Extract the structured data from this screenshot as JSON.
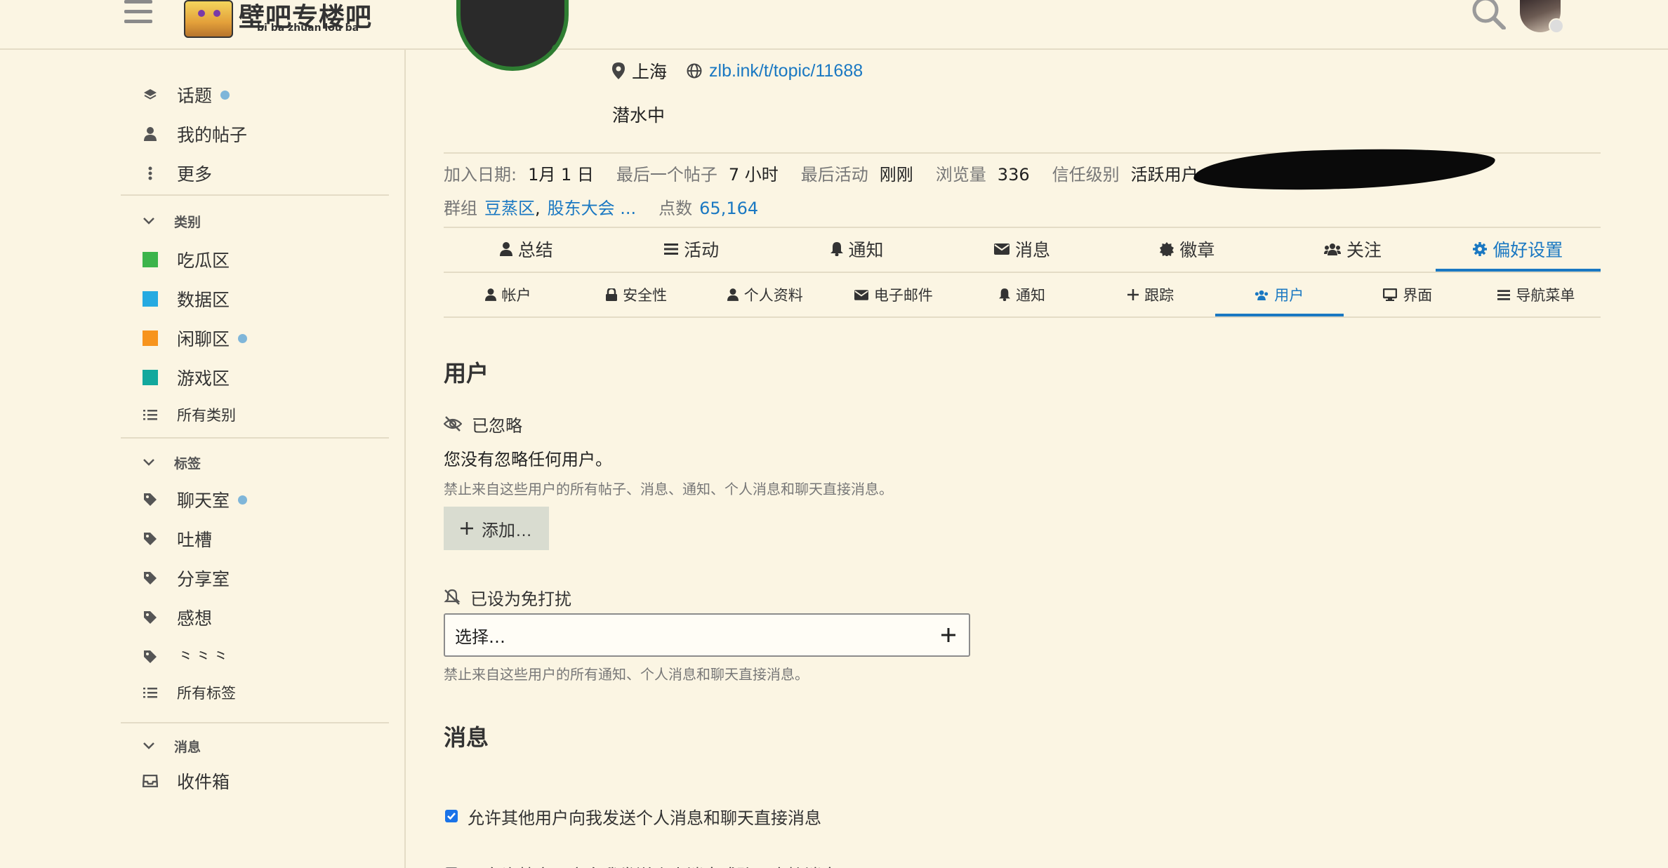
{
  "header": {
    "logo_title": "壁吧专楼吧",
    "logo_subtitle": "bi ba zhuan lou ba"
  },
  "sidebar": {
    "nav": [
      {
        "label": "话题",
        "icon": "layers-icon",
        "dot": true
      },
      {
        "label": "我的帖子",
        "icon": "user-icon",
        "dot": false
      },
      {
        "label": "更多",
        "icon": "vertical-ellipsis-icon",
        "dot": false
      }
    ],
    "categories_heading": "类别",
    "categories": [
      {
        "label": "吃瓜区",
        "color": "#3cb44b",
        "dot": false
      },
      {
        "label": "数据区",
        "color": "#25aae1",
        "dot": false
      },
      {
        "label": "闲聊区",
        "color": "#f7941d",
        "dot": true
      },
      {
        "label": "游戏区",
        "color": "#12a89d",
        "dot": false
      }
    ],
    "all_categories": "所有类别",
    "tags_heading": "标签",
    "tags": [
      {
        "label": "聊天室",
        "dot": true
      },
      {
        "label": "吐槽",
        "dot": false
      },
      {
        "label": "分享室",
        "dot": false
      },
      {
        "label": "感想",
        "dot": false
      },
      {
        "label": "⺀⺀⺀",
        "dot": false
      }
    ],
    "all_tags": "所有标签",
    "messages_heading": "消息",
    "inbox": "收件箱"
  },
  "profile": {
    "location": "上海",
    "website": "zlb.ink/t/topic/11688",
    "bio": "潜水中",
    "stats": {
      "joined_label": "加入日期:",
      "joined_value": "1月 1 日",
      "last_post_label": "最后一个帖子",
      "last_post_value": "7 小时",
      "last_activity_label": "最后活动",
      "last_activity_value": "刚刚",
      "views_label": "浏览量",
      "views_value": "336",
      "trust_label": "信任级别",
      "trust_value": "活跃用户",
      "groups_label": "群组",
      "group_1": "豆蒸区",
      "group_sep": ",",
      "group_2": "股东大会 ...",
      "points_label": "点数",
      "points_value": "65,164"
    }
  },
  "tabs": [
    {
      "label": "总结",
      "icon": "user-icon"
    },
    {
      "label": "活动",
      "icon": "list-icon"
    },
    {
      "label": "通知",
      "icon": "bell-icon"
    },
    {
      "label": "消息",
      "icon": "envelope-icon"
    },
    {
      "label": "徽章",
      "icon": "badge-icon"
    },
    {
      "label": "关注",
      "icon": "users-icon"
    },
    {
      "label": "偏好设置",
      "icon": "gear-icon",
      "active": true
    }
  ],
  "subtabs": [
    {
      "label": "帐户",
      "icon": "user-icon"
    },
    {
      "label": "安全性",
      "icon": "lock-icon"
    },
    {
      "label": "个人资料",
      "icon": "user-icon"
    },
    {
      "label": "电子邮件",
      "icon": "envelope-icon"
    },
    {
      "label": "通知",
      "icon": "bell-icon"
    },
    {
      "label": "跟踪",
      "icon": "plus-icon"
    },
    {
      "label": "用户",
      "icon": "users-icon",
      "active": true
    },
    {
      "label": "界面",
      "icon": "desktop-icon"
    },
    {
      "label": "导航菜单",
      "icon": "list-icon"
    }
  ],
  "users_section": {
    "heading": "用户",
    "ignored_label": "已忽略",
    "ignored_empty": "您没有忽略任何用户。",
    "ignored_hint": "禁止来自这些用户的所有帖子、消息、通知、个人消息和聊天直接消息。",
    "add_button": "添加…",
    "muted_label": "已设为免打扰",
    "muted_placeholder": "选择…",
    "muted_hint": "禁止来自这些用户的所有通知、个人消息和聊天直接消息。"
  },
  "messages_section": {
    "heading": "消息",
    "allow_pm": "允许其他用户向我发送个人消息和聊天直接消息",
    "allow_pm_checked": true,
    "only_specific": "只允许特定用户向我发送个人消息或聊天直接消息",
    "only_specific_checked": false
  },
  "colors": {
    "background": "#fbf5e3",
    "accent": "#1a78c2",
    "checkbox": "#1a73e8"
  }
}
